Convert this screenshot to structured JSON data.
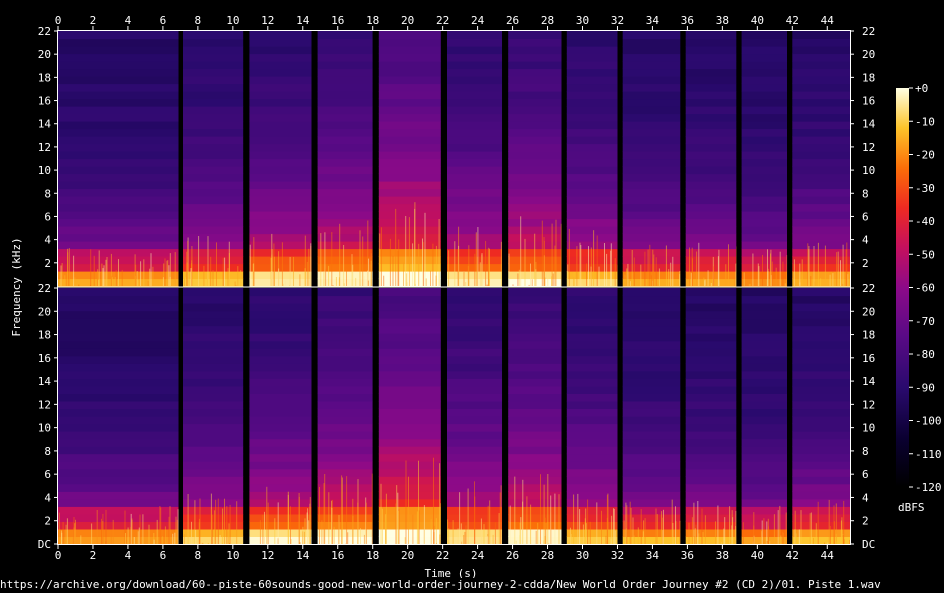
{
  "chart_data": {
    "type": "heatmap",
    "xlabel": "Time (s)",
    "ylabel": "Frequency (kHz)",
    "xlim": [
      0,
      45.3
    ],
    "ylim": [
      0,
      22
    ],
    "x_ticks": [
      "0",
      "2",
      "4",
      "6",
      "8",
      "10",
      "12",
      "14",
      "16",
      "18",
      "20",
      "22",
      "24",
      "26",
      "28",
      "30",
      "32",
      "34",
      "36",
      "38",
      "40",
      "42",
      "44"
    ],
    "y_ticks": [
      "DC",
      "2",
      "4",
      "6",
      "8",
      "10",
      "12",
      "14",
      "16",
      "18",
      "20",
      "22"
    ],
    "colorbar": {
      "label": "dBFS",
      "range": [
        -120,
        0
      ],
      "ticks": [
        "+0",
        "-10",
        "-20",
        "-30",
        "-40",
        "-50",
        "-60",
        "-70",
        "-80",
        "-90",
        "-100",
        "-110",
        "-120"
      ]
    },
    "channels": [
      {
        "segments": [
          {
            "start": 0.0,
            "end": 6.9,
            "energy": 0.55,
            "top_khz": 6,
            "gap": 0.25
          },
          {
            "start": 7.15,
            "end": 10.6,
            "energy": 0.6,
            "top_khz": 8,
            "gap": 0.35
          },
          {
            "start": 10.95,
            "end": 14.5,
            "energy": 0.68,
            "top_khz": 9,
            "gap": 0.35
          },
          {
            "start": 14.85,
            "end": 18.0,
            "energy": 0.7,
            "top_khz": 11,
            "gap": 0.35
          },
          {
            "start": 18.35,
            "end": 21.9,
            "energy": 0.78,
            "top_khz": 14,
            "gap": 0.35
          },
          {
            "start": 22.25,
            "end": 25.4,
            "energy": 0.65,
            "top_khz": 10,
            "gap": 0.35
          },
          {
            "start": 25.75,
            "end": 28.8,
            "energy": 0.7,
            "top_khz": 11,
            "gap": 0.3
          },
          {
            "start": 29.1,
            "end": 32.0,
            "energy": 0.62,
            "top_khz": 9,
            "gap": 0.3
          },
          {
            "start": 32.3,
            "end": 35.6,
            "energy": 0.55,
            "top_khz": 7,
            "gap": 0.3
          },
          {
            "start": 35.9,
            "end": 38.8,
            "energy": 0.55,
            "top_khz": 7,
            "gap": 0.3
          },
          {
            "start": 39.1,
            "end": 41.7,
            "energy": 0.52,
            "top_khz": 6,
            "gap": 0.3
          },
          {
            "start": 42.0,
            "end": 45.3,
            "energy": 0.58,
            "top_khz": 7,
            "gap": 0.0
          }
        ]
      },
      {
        "segments": [
          {
            "start": 0.0,
            "end": 6.9,
            "energy": 0.55,
            "top_khz": 6,
            "gap": 0.25
          },
          {
            "start": 7.15,
            "end": 10.6,
            "energy": 0.6,
            "top_khz": 8,
            "gap": 0.35
          },
          {
            "start": 10.95,
            "end": 14.5,
            "energy": 0.68,
            "top_khz": 9,
            "gap": 0.35
          },
          {
            "start": 14.85,
            "end": 18.0,
            "energy": 0.7,
            "top_khz": 11,
            "gap": 0.35
          },
          {
            "start": 18.35,
            "end": 21.9,
            "energy": 0.78,
            "top_khz": 14,
            "gap": 0.35
          },
          {
            "start": 22.25,
            "end": 25.4,
            "energy": 0.65,
            "top_khz": 10,
            "gap": 0.35
          },
          {
            "start": 25.75,
            "end": 28.8,
            "energy": 0.7,
            "top_khz": 11,
            "gap": 0.3
          },
          {
            "start": 29.1,
            "end": 32.0,
            "energy": 0.62,
            "top_khz": 9,
            "gap": 0.3
          },
          {
            "start": 32.3,
            "end": 35.6,
            "energy": 0.55,
            "top_khz": 7,
            "gap": 0.3
          },
          {
            "start": 35.9,
            "end": 38.8,
            "energy": 0.55,
            "top_khz": 7,
            "gap": 0.3
          },
          {
            "start": 39.1,
            "end": 41.7,
            "energy": 0.52,
            "top_khz": 6,
            "gap": 0.3
          },
          {
            "start": 42.0,
            "end": 45.3,
            "energy": 0.58,
            "top_khz": 7,
            "gap": 0.0
          }
        ]
      }
    ]
  },
  "footer": {
    "path": "https://archive.org/download/60--piste-60sounds-good-new-world-order-journey-2-cdda/New World Order Journey #2 (CD 2)/01. Piste 1.wav"
  }
}
